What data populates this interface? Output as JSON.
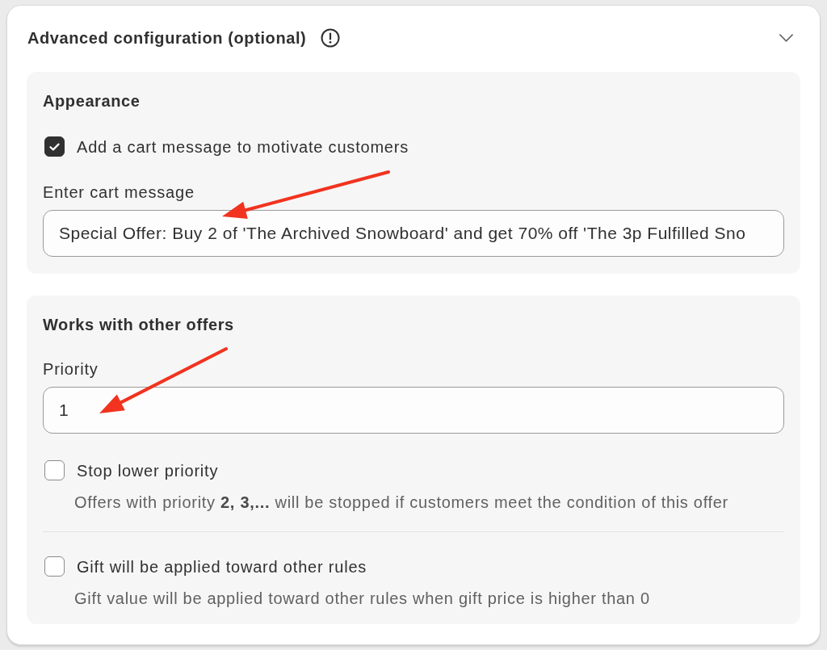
{
  "panel": {
    "title": "Advanced configuration (optional)"
  },
  "sections": [
    {
      "title": "Appearance",
      "items": [
        {
          "kind": "checkbox",
          "label": "Add a cart message to motivate customers",
          "checked": true
        },
        {
          "kind": "text_field",
          "label": "Enter cart message",
          "value": "Special Offer: Buy 2 of 'The Archived Snowboard' and get 70% off 'The 3p Fulfilled Sno"
        }
      ]
    },
    {
      "title": "Works with other offers",
      "items": [
        {
          "kind": "text_field",
          "label": "Priority",
          "value": "1"
        },
        {
          "kind": "checkbox",
          "label": "Stop lower priority",
          "checked": false,
          "help": "Offers with priority **2, 3,...** will be stopped if customers meet the condition of this offer"
        },
        {
          "kind": "checkbox",
          "label": "Gift will be applied toward other rules",
          "checked": false,
          "help": "Gift value will be applied toward other rules when gift price is higher than 0"
        }
      ]
    }
  ]
}
